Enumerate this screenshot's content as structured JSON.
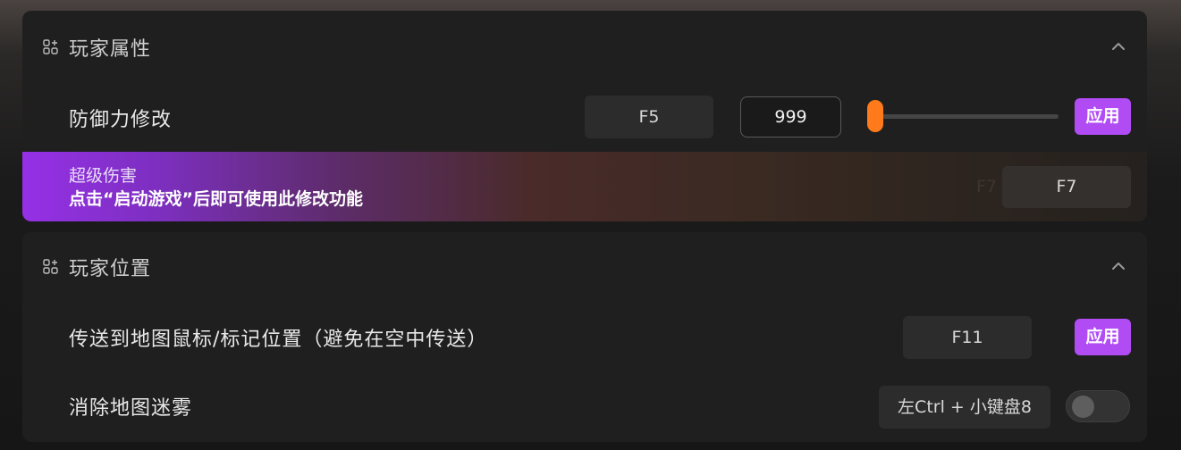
{
  "sections": [
    {
      "title": "玩家属性",
      "icon": "apps-add-icon",
      "collapse_icon": "chevron-up-icon",
      "rows": [
        {
          "label": "防御力修改",
          "hotkey": "F5",
          "value": "999",
          "slider_level": 0.0,
          "apply_label": "应用"
        }
      ],
      "promo": {
        "title": "超级伤害",
        "subtitle": "点击“启动游戏”后即可使用此修改功能",
        "ghost_hotkey": "F7",
        "hotkey": "F7"
      }
    },
    {
      "title": "玩家位置",
      "icon": "apps-add-icon",
      "collapse_icon": "chevron-up-icon",
      "rows": [
        {
          "label": "传送到地图鼠标/标记位置（避免在空中传送）",
          "hotkey": "F11",
          "apply_label": "应用"
        },
        {
          "label": "消除地图迷雾",
          "hotkey": "左Ctrl + 小键盘8",
          "toggle_on": false
        }
      ]
    }
  ],
  "colors": {
    "accent_purple": "#b14cf5",
    "slider_orange": "#ff7a1a",
    "panel_bg": "#1f1f1f"
  }
}
